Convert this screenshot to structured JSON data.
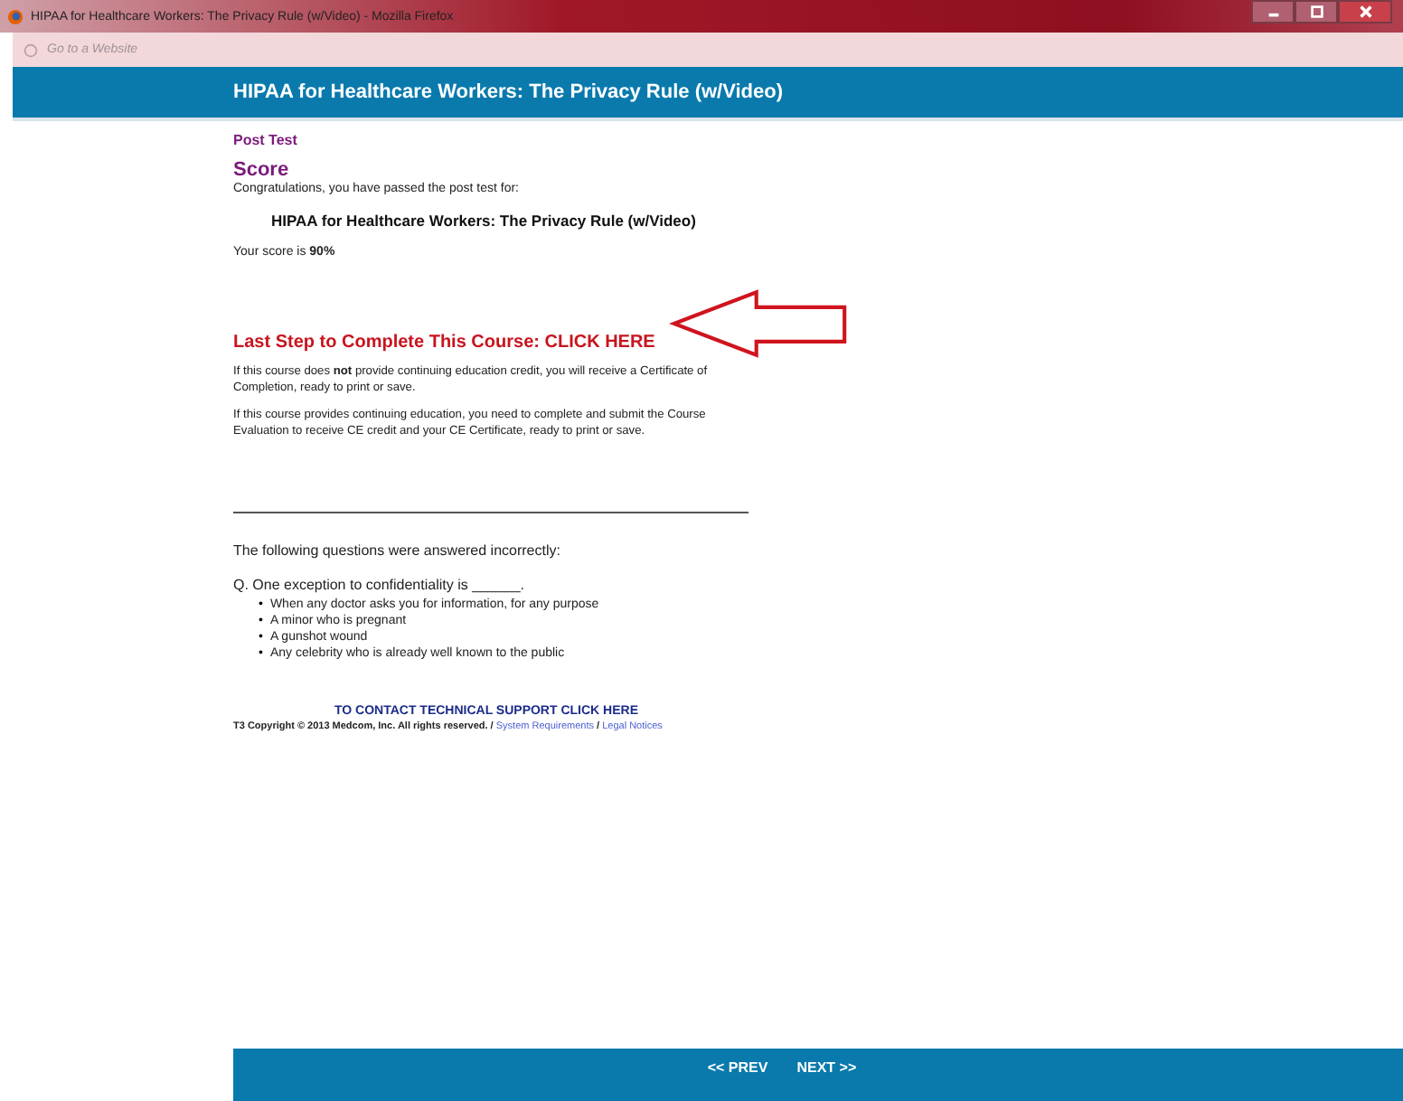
{
  "window": {
    "title": "HIPAA for Healthcare Workers: The Privacy Rule (w/Video) - Mozilla Firefox"
  },
  "address_bar": {
    "placeholder": "Go to a Website"
  },
  "header": {
    "title": "HIPAA for Healthcare Workers: The Privacy Rule (w/Video)"
  },
  "section_label": "Post Test",
  "heading": "Score",
  "congrats": "Congratulations, you have passed the post test for:",
  "course_title": "HIPAA for Healthcare Workers: The Privacy Rule (w/Video)",
  "score_line": "Your score is **90%**",
  "last_step": "Last Step to Complete This Course: CLICK HERE",
  "paragraphs": [
    "If this course does **not** provide continuing education credit, you will receive a Certificate of Completion, ready to print or save.",
    "If this course provides continuing education, you need to complete and submit the Course Evaluation to receive CE credit and your CE Certificate, ready to print or save."
  ],
  "incorrect_intro": "The following questions were answered incorrectly:",
  "questions": [
    {
      "question": "Q. One exception to confidentiality is ______.",
      "bullet": "•",
      "answers": [
        "When any doctor asks you for information, for any purpose",
        "A minor who is pregnant",
        "A gunshot wound",
        "Any celebrity who is already well known to the public"
      ]
    }
  ],
  "support_link": "TO CONTACT TECHNICAL SUPPORT CLICK HERE",
  "copyright": "T3 Copyright © 2013 Medcom, Inc. All rights reserved. / ",
  "footer_links": [
    "System Requirements",
    "Legal Notices"
  ],
  "footer_separator": " / ",
  "nav": [
    "<< PREV",
    "NEXT >>"
  ]
}
